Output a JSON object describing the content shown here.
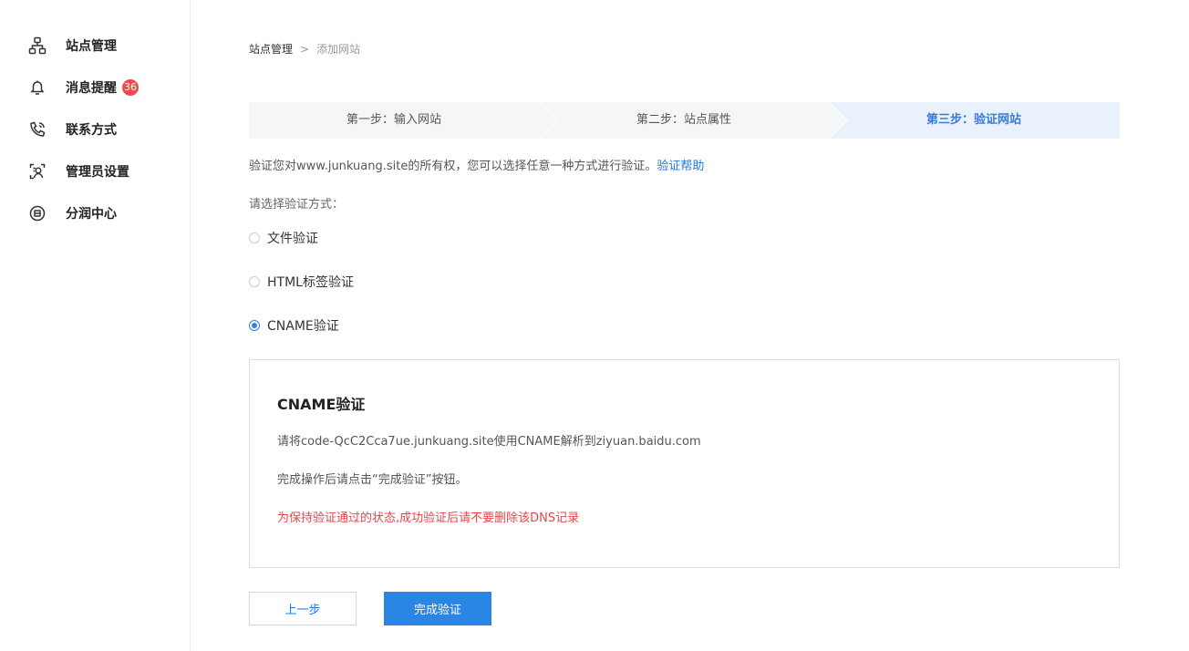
{
  "sidebar": {
    "items": [
      {
        "label": "站点管理",
        "icon": "sitemap-icon"
      },
      {
        "label": "消息提醒",
        "icon": "bell-icon",
        "badge": "36"
      },
      {
        "label": "联系方式",
        "icon": "phone-icon"
      },
      {
        "label": "管理员设置",
        "icon": "admin-user-icon"
      },
      {
        "label": "分润中心",
        "icon": "profit-share-icon"
      }
    ]
  },
  "breadcrumb": {
    "parent": "站点管理",
    "separator": ">",
    "current": "添加网站"
  },
  "steps": [
    {
      "label": "第一步：输入网站",
      "state": "done"
    },
    {
      "label": "第二步：站点属性",
      "state": "done"
    },
    {
      "label": "第三步：验证网站",
      "state": "active"
    }
  ],
  "description": {
    "text": "验证您对www.junkuang.site的所有权，您可以选择任意一种方式进行验证。",
    "help_link": "验证帮助"
  },
  "method_prompt": "请选择验证方式：",
  "methods": [
    {
      "label": "文件验证",
      "checked": false
    },
    {
      "label": "HTML标签验证",
      "checked": false
    },
    {
      "label": "CNAME验证",
      "checked": true
    }
  ],
  "panel": {
    "title": "CNAME验证",
    "instruction": "请将code-QcC2Cca7ue.junkuang.site使用CNAME解析到ziyuan.baidu.com",
    "after_action": "完成操作后请点击“完成验证”按钮。",
    "warning": "为保持验证通过的状态,成功验证后请不要删除该DNS记录"
  },
  "buttons": {
    "prev": "上一步",
    "done": "完成验证"
  },
  "colors": {
    "accent": "#2b85e4",
    "link": "#1f7ae0",
    "warning": "#e84545",
    "badge": "#f04b4b",
    "step_inactive_bg": "#f5f6f8",
    "step_active_bg": "#e8f1fc"
  }
}
